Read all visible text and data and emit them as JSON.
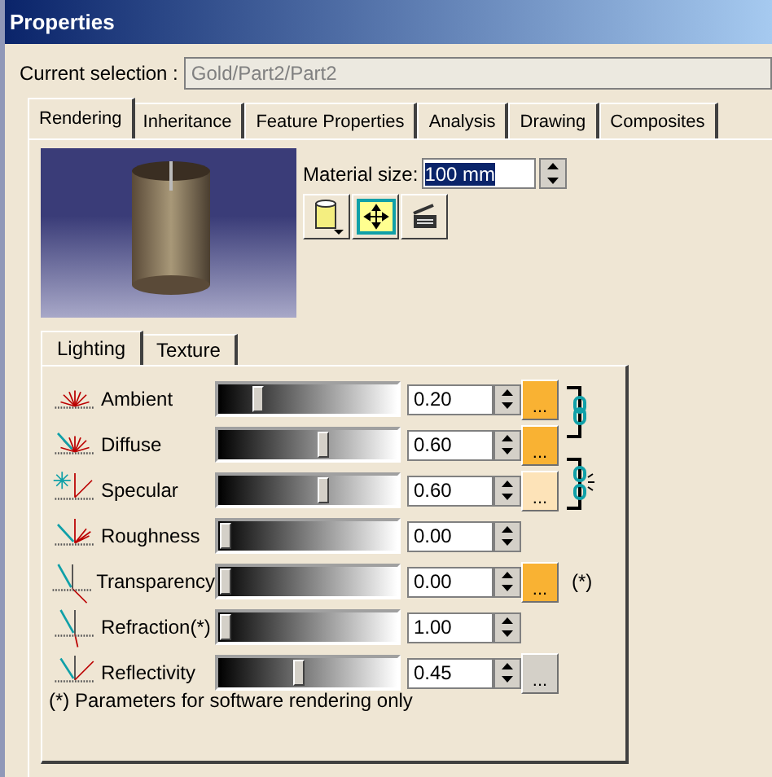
{
  "window": {
    "title": "Properties"
  },
  "current_selection": {
    "label": "Current selection :",
    "value": "Gold/Part2/Part2",
    "disabled": true
  },
  "tabs": [
    {
      "label": "Rendering",
      "selected": true
    },
    {
      "label": "Inheritance",
      "selected": false
    },
    {
      "label": "Feature Properties",
      "selected": false
    },
    {
      "label": "Analysis",
      "selected": false
    },
    {
      "label": "Drawing",
      "selected": false
    },
    {
      "label": "Composites",
      "selected": false
    }
  ],
  "material_size": {
    "label": "Material size:",
    "value": "100 mm"
  },
  "sub_tabs": [
    {
      "label": "Lighting",
      "selected": true
    },
    {
      "label": "Texture",
      "selected": false
    }
  ],
  "properties": [
    {
      "kind": "ambient",
      "name": "Ambient",
      "level": 0.2,
      "reading": "0.20",
      "swatch": {
        "label": "...",
        "color": "#f9b233"
      }
    },
    {
      "kind": "diffuse",
      "name": "Diffuse",
      "level": 0.6,
      "reading": "0.60",
      "swatch": {
        "label": "...",
        "color": "#f9b233"
      }
    },
    {
      "kind": "specular",
      "name": "Specular",
      "level": 0.6,
      "reading": "0.60",
      "swatch": {
        "label": "...",
        "color": "#fde3b8"
      }
    },
    {
      "kind": "roughness",
      "name": "Roughness",
      "level": 0,
      "reading": "0.00"
    },
    {
      "kind": "transparency",
      "name": "Transparency",
      "level": 0,
      "reading": "0.00",
      "swatch": {
        "label": "...",
        "color": "#f9b233"
      },
      "note": "(*)"
    },
    {
      "kind": "refraction",
      "name": "Refraction(*)",
      "level": 0,
      "reading": "1.00"
    },
    {
      "kind": "reflectivity",
      "name": "Reflectivity",
      "level": 0.45,
      "reading": "0.45",
      "swatch": {
        "label": "...",
        "color": "#d4d0c8"
      }
    }
  ],
  "links": [
    {
      "linked": true
    },
    {
      "linked": false
    }
  ],
  "footnote": "(*) Parameters for software rendering only"
}
